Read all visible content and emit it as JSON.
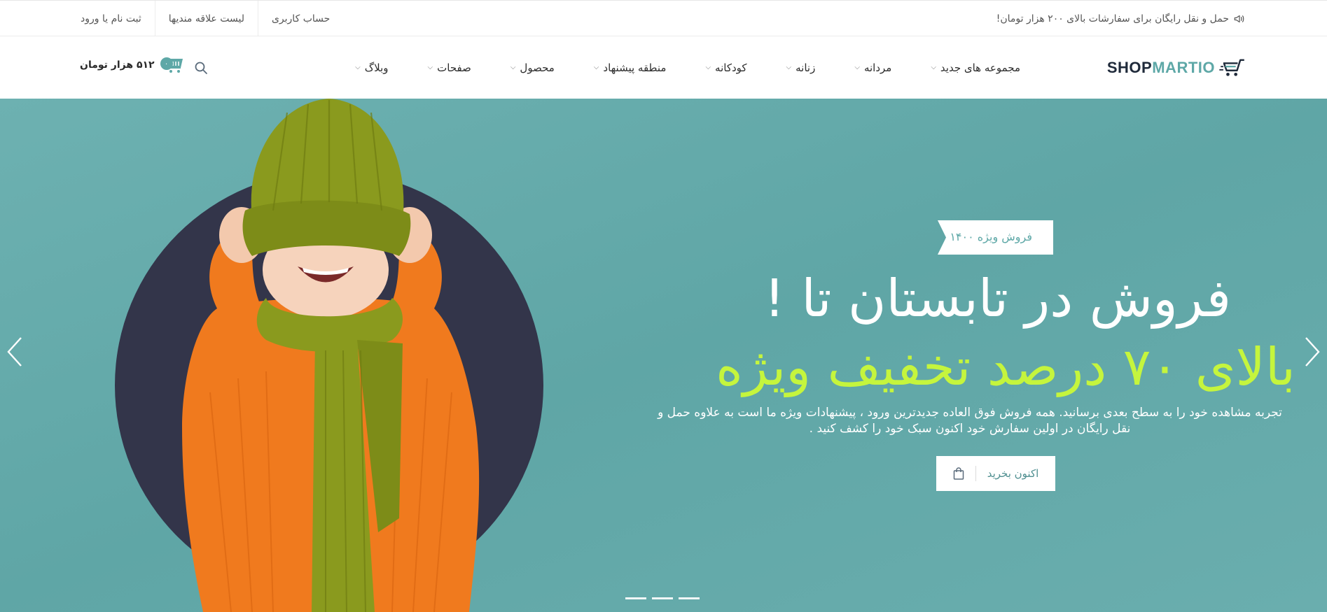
{
  "topbar": {
    "announcement": "حمل و نقل رایگان برای سفارشات بالای ۲۰۰ هزار تومان!",
    "links": [
      {
        "label": "حساب کاربری"
      },
      {
        "label": "لیست علاقه مندیها"
      },
      {
        "label": "ثبت نام یا ورود"
      }
    ]
  },
  "header": {
    "logo": {
      "part1": "SHOP",
      "part2": "MARTIO"
    },
    "nav": [
      {
        "label": "مجموعه های جدید"
      },
      {
        "label": "مردانه"
      },
      {
        "label": "زنانه"
      },
      {
        "label": "کودکانه"
      },
      {
        "label": "منطقه پیشنهاد"
      },
      {
        "label": "محصول"
      },
      {
        "label": "صفحات"
      },
      {
        "label": "وبلاگ"
      }
    ],
    "cart": {
      "count": "۰",
      "amount": "۵۱۲ هزار تومان"
    }
  },
  "hero": {
    "tag": "فروش ویژه ۱۴۰۰",
    "title": "فروش در تابستان تا !",
    "subtitle": "بالای ۷۰ درصد تخفیف ویژه",
    "description": "تجربه مشاهده خود را به سطح بعدی برسانید. همه فروش فوق العاده جدیدترین ورود ، پیشنهادات ویژه ما است به علاوه حمل و نقل رایگان در اولین سفارش خود اکنون سبک خود را کشف کنید .",
    "cta_label": "اکنون بخرید"
  },
  "colors": {
    "accent": "#5ea8a7",
    "hero_bg": "#64abab",
    "highlight": "#c5f53d",
    "circle": "#33354a",
    "sweater": "#f07a1e",
    "knit": "#8a9a1e"
  }
}
